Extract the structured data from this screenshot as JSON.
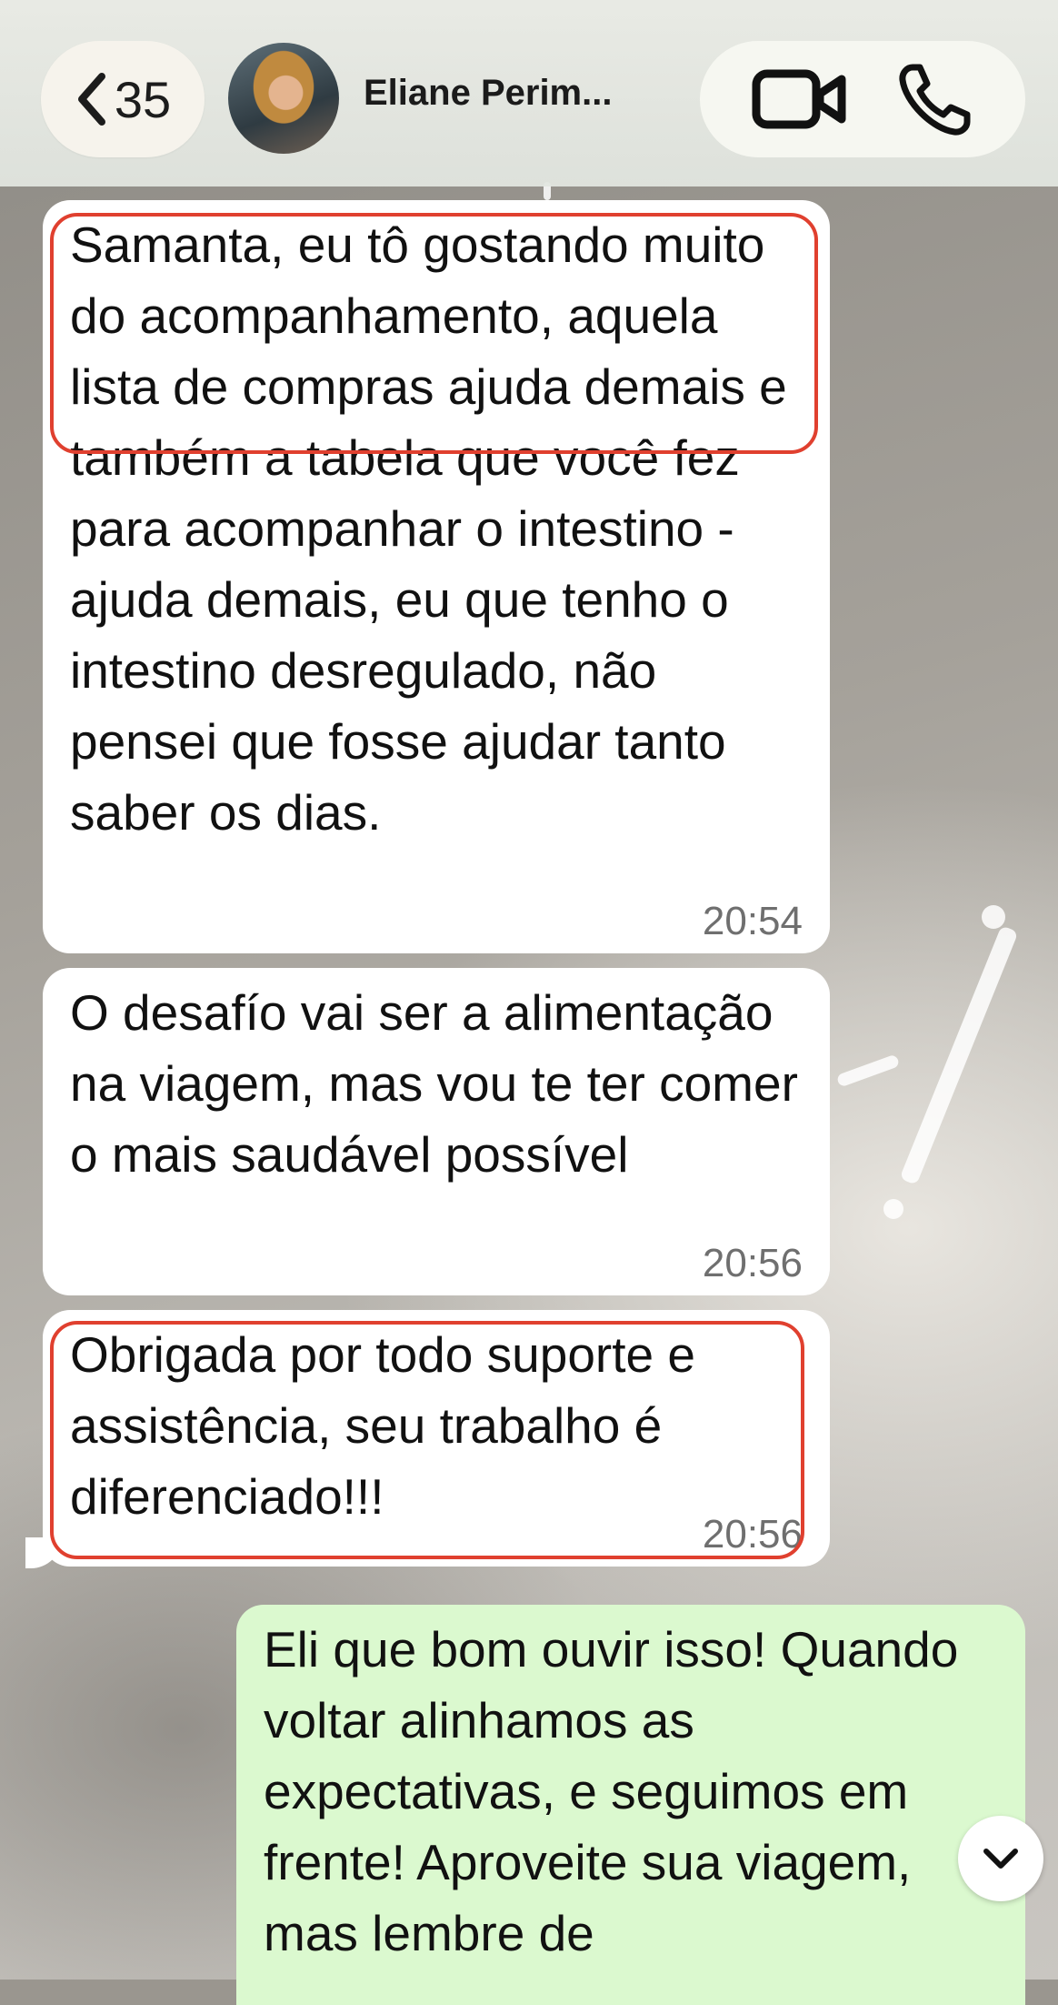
{
  "header": {
    "back_count": "35",
    "contact_name": "Eliane Perim..."
  },
  "messages": [
    {
      "direction": "incoming",
      "text": "Samanta, eu tô gostando muito do acompanhamento, aquela lista de compras ajuda demais e também a tabela que você fez para acompanhar o intestino - ajuda demais, eu que tenho o intestino desregulado, não pensei que fosse ajudar tanto saber os dias.",
      "time": "20:54",
      "highlighted": true
    },
    {
      "direction": "incoming",
      "text": "O desafío vai ser a alimentação na viagem, mas vou te ter comer o mais saudável possível",
      "time": "20:56",
      "highlighted": false
    },
    {
      "direction": "incoming",
      "text": "Obrigada por todo suporte e assistência, seu trabalho é diferenciado!!!",
      "time": "20:56",
      "highlighted": true
    },
    {
      "direction": "outgoing",
      "text": "Eli que bom ouvir isso! Quando voltar alinhamos as expectativas, e seguimos em frente! Aproveite sua viagem, mas lembre de",
      "time": "",
      "highlighted": false
    }
  ],
  "icons": {
    "back": "chevron-left-icon",
    "video": "video-call-icon",
    "phone": "phone-icon",
    "scroll": "chevron-down-icon"
  },
  "colors": {
    "incoming_bubble": "#ffffff",
    "outgoing_bubble": "#dbf9cf",
    "highlight_border": "#e0402f"
  }
}
